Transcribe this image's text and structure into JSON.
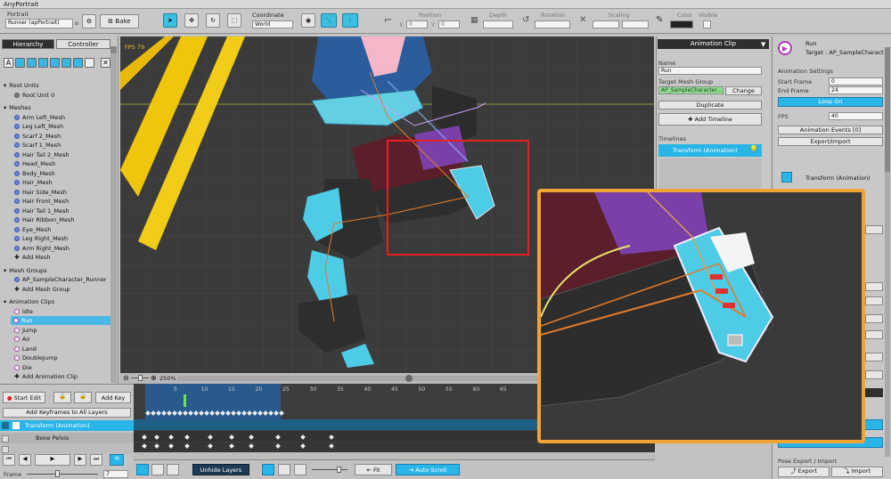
{
  "window_title": "AnyPortrait",
  "toolbar": {
    "portrait_label": "Portrait",
    "portrait_value": "Runner (apPortrait)",
    "portrait_value_suffix": "o",
    "bake_label": "Bake",
    "coordinate_label": "Coordinate",
    "coordinate_value": "World",
    "position_label": "Position",
    "depth_label": "Depth",
    "rotation_label": "Rotation",
    "scaling_label": "Scaling",
    "color_label": "Color",
    "visible_label": "Visible",
    "x_label": "X",
    "x_value": "0",
    "y_label": "Y",
    "y_value": "0"
  },
  "left_panel": {
    "tabs": [
      "Hierarchy",
      "Controller"
    ],
    "active_tab": 0,
    "sections": [
      {
        "header": "Root Units",
        "items": [
          "Root Unit 0"
        ]
      },
      {
        "header": "Meshes",
        "items": [
          "Arm Left_Mesh",
          "Leg Left_Mesh",
          "Scarf 2_Mesh",
          "Scarf 1_Mesh",
          "Hair Tail 2_Mesh",
          "Head_Mesh",
          "Body_Mesh",
          "Hair_Mesh",
          "Hair Side_Mesh",
          "Hair Front_Mesh",
          "Hair Tail 1_Mesh",
          "Hair Ribbon_Mesh",
          "Eye_Mesh",
          "Leg Right_Mesh",
          "Arm Right_Mesh"
        ],
        "add": "Add Mesh"
      },
      {
        "header": "Mesh Groups",
        "items": [
          "AP_SampleCharacter_Runner"
        ],
        "add": "Add Mesh Group"
      },
      {
        "header": "Animation Clips",
        "items": [
          "Idle",
          "Run",
          "Jump",
          "Air",
          "Land",
          "DoubleJump",
          "Die"
        ],
        "selected": "Run",
        "add": "Add Animation Clip"
      }
    ]
  },
  "viewport": {
    "fps": "FPS 79",
    "zoom": "250%"
  },
  "animation_clip_panel": {
    "header": "Animation Clip",
    "name_label": "Name",
    "name_value": "Run",
    "target_label": "Target Mesh Group",
    "target_value": "AP_SampleCharacter...",
    "change": "Change",
    "duplicate": "Duplicate",
    "add_timeline": "Add Timeline",
    "timelines_label": "Timelines",
    "timeline_item": "Transform (Animation)"
  },
  "properties_panel": {
    "clip_name": "Run",
    "target": "Target : AP_SampleCharact",
    "settings_label": "Animation Settings",
    "start_label": "Start Frame",
    "start_value": "0",
    "end_label": "End Frame",
    "end_value": "24",
    "loop_on": "Loop On",
    "fps_label": "FPS",
    "fps_value": "40",
    "events": "Animation Events [0]",
    "export_import": "Export/Import",
    "transform_label": "Transform (Animation)",
    "pose_label": "Pose Export / Import",
    "export": "Export",
    "import": "Import"
  },
  "timeline_panel": {
    "start_edit": "Start Edit",
    "add_key": "Add Key",
    "add_keyframes_all": "Add Keyframes to All Layers",
    "layer": "Transform (Animation)",
    "bone": "Bone Pelvis",
    "frame_label": "Frame",
    "frame_value": "7",
    "ruler": [
      "5",
      "10",
      "15",
      "20",
      "25",
      "30",
      "35",
      "40",
      "45",
      "50",
      "55",
      "60",
      "65"
    ],
    "unhide_layers": "Unhide Layers",
    "fit": "Fit",
    "auto_scroll": "Auto Scroll"
  }
}
